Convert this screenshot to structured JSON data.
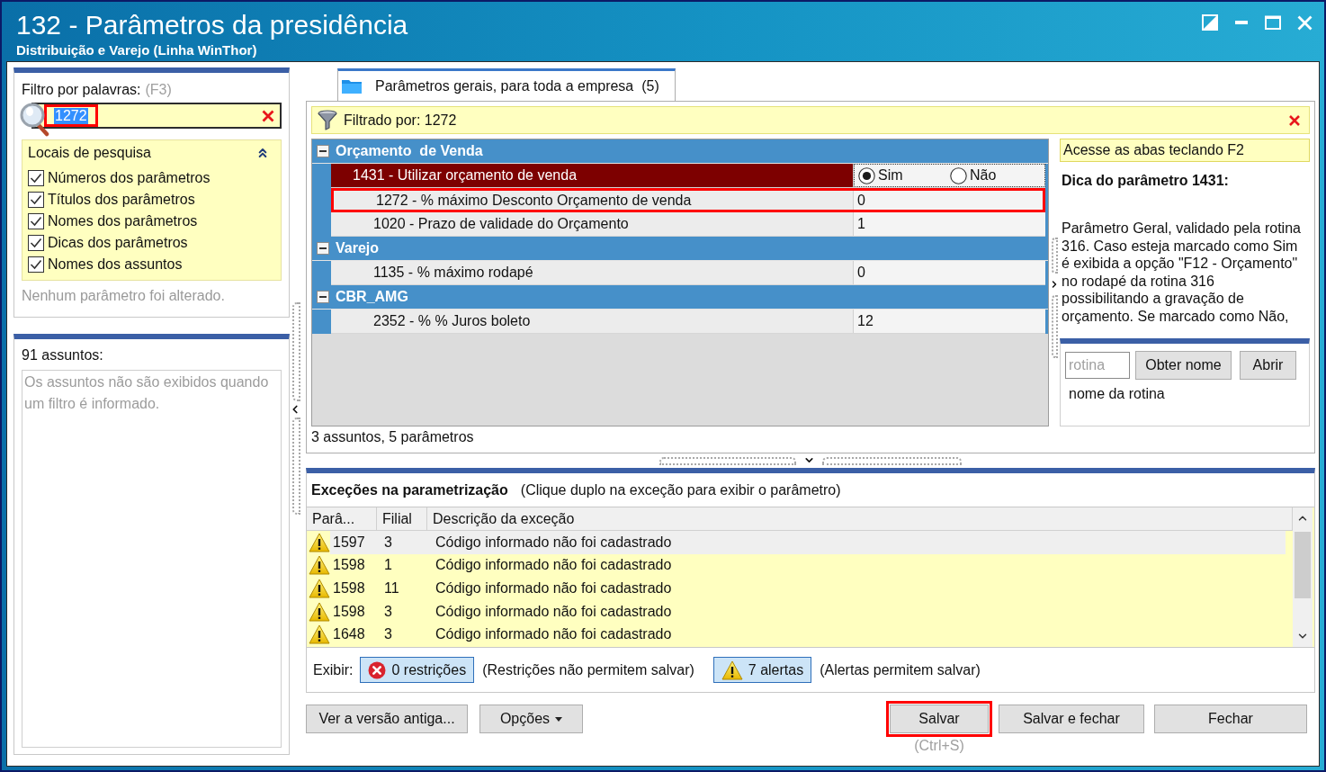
{
  "window": {
    "title": "132 - Parâmetros da presidência",
    "subtitle": "Distribuição e Varejo (Linha WinThor)"
  },
  "filter_panel": {
    "label": "Filtro por palavras:",
    "shortcut": "(F3)",
    "search": {
      "value": "1272",
      "value_selected": true,
      "highlighted": true
    },
    "search_locations": {
      "title": "Locais de pesquisa",
      "expanded": true,
      "items": [
        {
          "label": "Números dos parâmetros",
          "checked": true
        },
        {
          "label": "Títulos dos parâmetros",
          "checked": true
        },
        {
          "label": "Nomes dos parâmetros",
          "checked": true
        },
        {
          "label": "Dicas dos parâmetros",
          "checked": true
        },
        {
          "label": "Nomes dos assuntos",
          "checked": true
        }
      ]
    },
    "status": "Nenhum parâmetro foi alterado."
  },
  "subjects_panel": {
    "title": "91 assuntos:",
    "empty_message": "Os assuntos não são exibidos quando um filtro é informado."
  },
  "tabs": [
    {
      "label": "Parâmetros gerais, para toda a empresa  (5)",
      "selected": true
    }
  ],
  "filter_bar": {
    "text": "Filtrado por: 1272"
  },
  "parameter_groups": [
    {
      "name": "Orçamento  de Venda",
      "expanded": true,
      "rows": [
        {
          "kind": "choice",
          "label": "1431 - Utilizar orçamento de venda",
          "selected": true,
          "highlighted": false,
          "options": [
            {
              "label": "Sim",
              "selected": true
            },
            {
              "label": "Não",
              "selected": false
            }
          ]
        },
        {
          "kind": "text",
          "label": "1272 - % máximo Desconto Orçamento de venda",
          "value": "0",
          "selected": false,
          "highlighted": true
        },
        {
          "kind": "text",
          "label": "1020 - Prazo de validade do Orçamento",
          "value": "1",
          "selected": false,
          "highlighted": false
        }
      ]
    },
    {
      "name": "Varejo",
      "expanded": true,
      "rows": [
        {
          "kind": "text",
          "label": "1135 - % máximo rodapé",
          "value": "0",
          "selected": false,
          "highlighted": false
        }
      ]
    },
    {
      "name": "CBR_AMG",
      "expanded": true,
      "rows": [
        {
          "kind": "text",
          "label": "2352 - % % Juros boleto",
          "value": "12",
          "selected": false,
          "highlighted": false
        }
      ]
    }
  ],
  "summary": "3 assuntos, 5 parâmetros",
  "tip_panel": {
    "hint": "Acesse as abas teclando F2",
    "title": "Dica do parâmetro 1431:",
    "text": "Parâmetro Geral, validado pela rotina\n316. Caso esteja marcado como Sim\né exibida a opção \"F12 - Orçamento\"\nno rodapé da rotina 316\npossibilitando a gravação de\norçamento. Se marcado como Não,"
  },
  "routine_lookup": {
    "placeholder": "rotina",
    "buttons": [
      "Obter nome",
      "Abrir"
    ],
    "result": "nome da rotina"
  },
  "exceptions": {
    "title": "Exceções na parametrização",
    "note": "(Clique duplo na exceção para exibir o parâmetro)",
    "columns": [
      "Parâ...",
      "Filial",
      "Descrição da exceção"
    ],
    "rows": [
      {
        "kind": "alert",
        "parameter": "1597",
        "branch": "3",
        "description": "Código informado não foi cadastrado",
        "selected": true
      },
      {
        "kind": "alert",
        "parameter": "1598",
        "branch": "1",
        "description": "Código informado não foi cadastrado",
        "selected": false
      },
      {
        "kind": "alert",
        "parameter": "1598",
        "branch": "11",
        "description": "Código informado não foi cadastrado",
        "selected": false
      },
      {
        "kind": "alert",
        "parameter": "1598",
        "branch": "3",
        "description": "Código informado não foi cadastrado",
        "selected": false
      },
      {
        "kind": "alert",
        "parameter": "1648",
        "branch": "3",
        "description": "Código informado não foi cadastrado",
        "selected": false
      }
    ]
  },
  "display_filters": {
    "label": "Exibir:",
    "toggles": [
      {
        "kind": "restriction",
        "label": "0 restrições",
        "on": true,
        "note": "(Restrições não permitem salvar)"
      },
      {
        "kind": "alert",
        "label": "7 alertas",
        "on": true,
        "note": "(Alertas permitem salvar)"
      }
    ]
  },
  "buttons": [
    {
      "kind": "plain",
      "label": "Ver a versão antiga...",
      "highlighted": false
    },
    {
      "kind": "menu",
      "label": "Opções",
      "highlighted": false
    },
    {
      "kind": "plain",
      "label": "Salvar",
      "highlighted": true,
      "shortcut": "(Ctrl+S)"
    },
    {
      "kind": "plain",
      "label": "Salvar e fechar",
      "highlighted": false
    },
    {
      "kind": "plain",
      "label": "Fechar",
      "highlighted": false
    }
  ]
}
